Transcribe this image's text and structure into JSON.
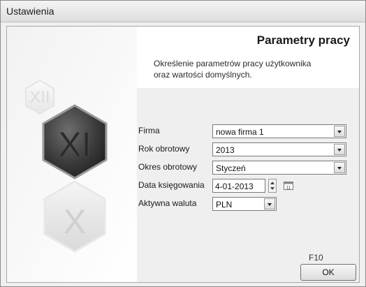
{
  "window": {
    "title": "Ustawienia"
  },
  "header": {
    "heading": "Parametry pracy",
    "description_line1": "Określenie parametrów pracy użytkownika",
    "description_line2": "oraz wartości domyślnych."
  },
  "decor": {
    "hex_top": "XII",
    "hex_mid": "XI",
    "hex_bottom": "X"
  },
  "form": {
    "company": {
      "label": "Firma",
      "value": "nowa firma 1"
    },
    "fiscal_year": {
      "label": "Rok obrotowy",
      "value": "2013"
    },
    "fiscal_period": {
      "label": "Okres obrotowy",
      "value": "Styczeń"
    },
    "posting_date": {
      "label": "Data księgowania",
      "value": "4-01-2013",
      "calendar_icon_text": "11"
    },
    "currency": {
      "label": "Aktywna waluta",
      "value": "PLN"
    }
  },
  "footer": {
    "shortcut": "F10",
    "ok_label": "OK"
  }
}
